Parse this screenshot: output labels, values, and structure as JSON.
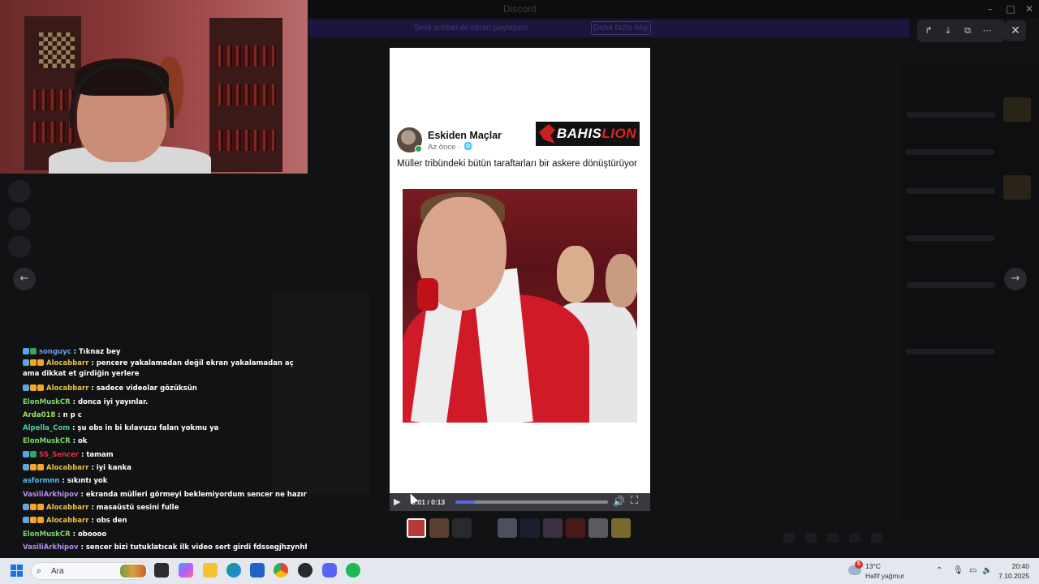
{
  "window": {
    "title": "Discord"
  },
  "banner": {
    "text": "Sesli sohbet ile ekran paylaşımı",
    "button": "Daha fazla bilgi"
  },
  "post": {
    "author": "Eskiden Maçlar",
    "time": "Az önce",
    "caption": "Müller tribündeki bütün taraftarları bir askere dönüştürüyor",
    "sponsor": {
      "part1": "BAHIS",
      "part2": "LION"
    }
  },
  "video": {
    "time": "0:01 / 0:13",
    "progress_fraction": 0.13
  },
  "chat": [
    {
      "badges": [
        "#5aa7e6",
        "#3ba55d"
      ],
      "user": "songuyc",
      "color": "#6aa0e8",
      "text": ": Tıknaz bey"
    },
    {
      "badges": [
        "#5aa7e6",
        "#f5a623",
        "#f5a623"
      ],
      "user": "Alocabbarr",
      "color": "#e6c14a",
      "text": ": pencere yakalamadan değil ekran yakalamadan aç ama dikkat et girdiğin yerlere",
      "wrap": true
    },
    {
      "badges": [
        "#5aa7e6",
        "#f5a623",
        "#f5a623"
      ],
      "user": "Alocabbarr",
      "color": "#e6c14a",
      "text": ": sadece videolar gözüksün"
    },
    {
      "badges": [],
      "user": "ElonMuskCR",
      "color": "#7fd86a",
      "text": ": donca iyi yayınlar."
    },
    {
      "badges": [],
      "user": "Arda018",
      "color": "#9be35a",
      "text": ": n p c"
    },
    {
      "badges": [],
      "user": "Alpella_Com",
      "color": "#4ad0a0",
      "text": ": şu obs in bi kılavuzu falan yokmu ya"
    },
    {
      "badges": [],
      "user": "ElonMuskCR",
      "color": "#7fd86a",
      "text": ": ok"
    },
    {
      "badges": [
        "#5aa7e6",
        "#3ba55d"
      ],
      "user": "SS_Sencer",
      "color": "#e0304a",
      "text": ": tamam"
    },
    {
      "badges": [
        "#5aa7e6",
        "#f5a623",
        "#f5a623"
      ],
      "user": "Alocabbarr",
      "color": "#e6c14a",
      "text": ": iyi kanka"
    },
    {
      "badges": [],
      "user": "asformnn",
      "color": "#5ab8f0",
      "text": ": sıkıntı yok"
    },
    {
      "badges": [],
      "user": "VasiliArkhipov",
      "color": "#b88ef0",
      "text": ": ekranda mülleri görmeyi beklemiyordum sencer ne hazırladı acaba"
    },
    {
      "badges": [
        "#5aa7e6",
        "#f5a623",
        "#f5a623"
      ],
      "user": "Alocabbarr",
      "color": "#e6c14a",
      "text": ": masaüstü sesini fulle"
    },
    {
      "badges": [
        "#5aa7e6",
        "#f5a623",
        "#f5a623"
      ],
      "user": "Alocabbarr",
      "color": "#e6c14a",
      "text": ": obs den"
    },
    {
      "badges": [],
      "user": "ElonMuskCR",
      "color": "#7fd86a",
      "text": ": oboooo"
    },
    {
      "badges": [],
      "user": "VasiliArkhipov",
      "color": "#b88ef0",
      "text": ": sencer bizi tutuklatıcak ilk video sert girdi fdssegjhzynhf"
    }
  ],
  "taskbar": {
    "search_placeholder": "Ara",
    "weather_badge": "5",
    "temperature": "13°C",
    "condition": "Hafif yağmur",
    "time": "20:40",
    "date": "7.10.2025"
  },
  "colors": {
    "accent": "#5865f2",
    "viewer_bg": "#ffffff",
    "overlay": "#0b0b0d"
  }
}
